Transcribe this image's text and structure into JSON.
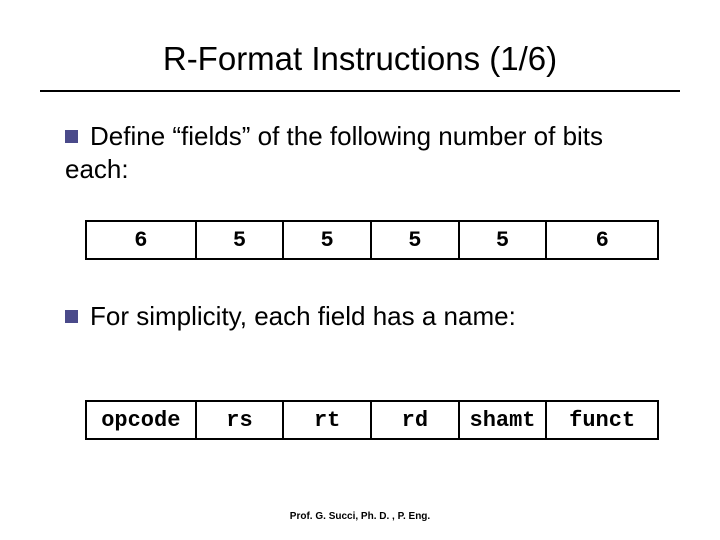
{
  "title": "R-Format Instructions (1/6)",
  "bullet1": "Define “fields” of the following number of bits each:",
  "bullet2": "For simplicity, each field has a name:",
  "bits": {
    "b0": "6",
    "b1": "5",
    "b2": "5",
    "b3": "5",
    "b4": "5",
    "b5": "6"
  },
  "names": {
    "n0": "opcode",
    "n1": "rs",
    "n2": "rt",
    "n3": "rd",
    "n4": "shamt",
    "n5": "funct"
  },
  "footer": "Prof. G. Succi, Ph. D. , P. Eng."
}
